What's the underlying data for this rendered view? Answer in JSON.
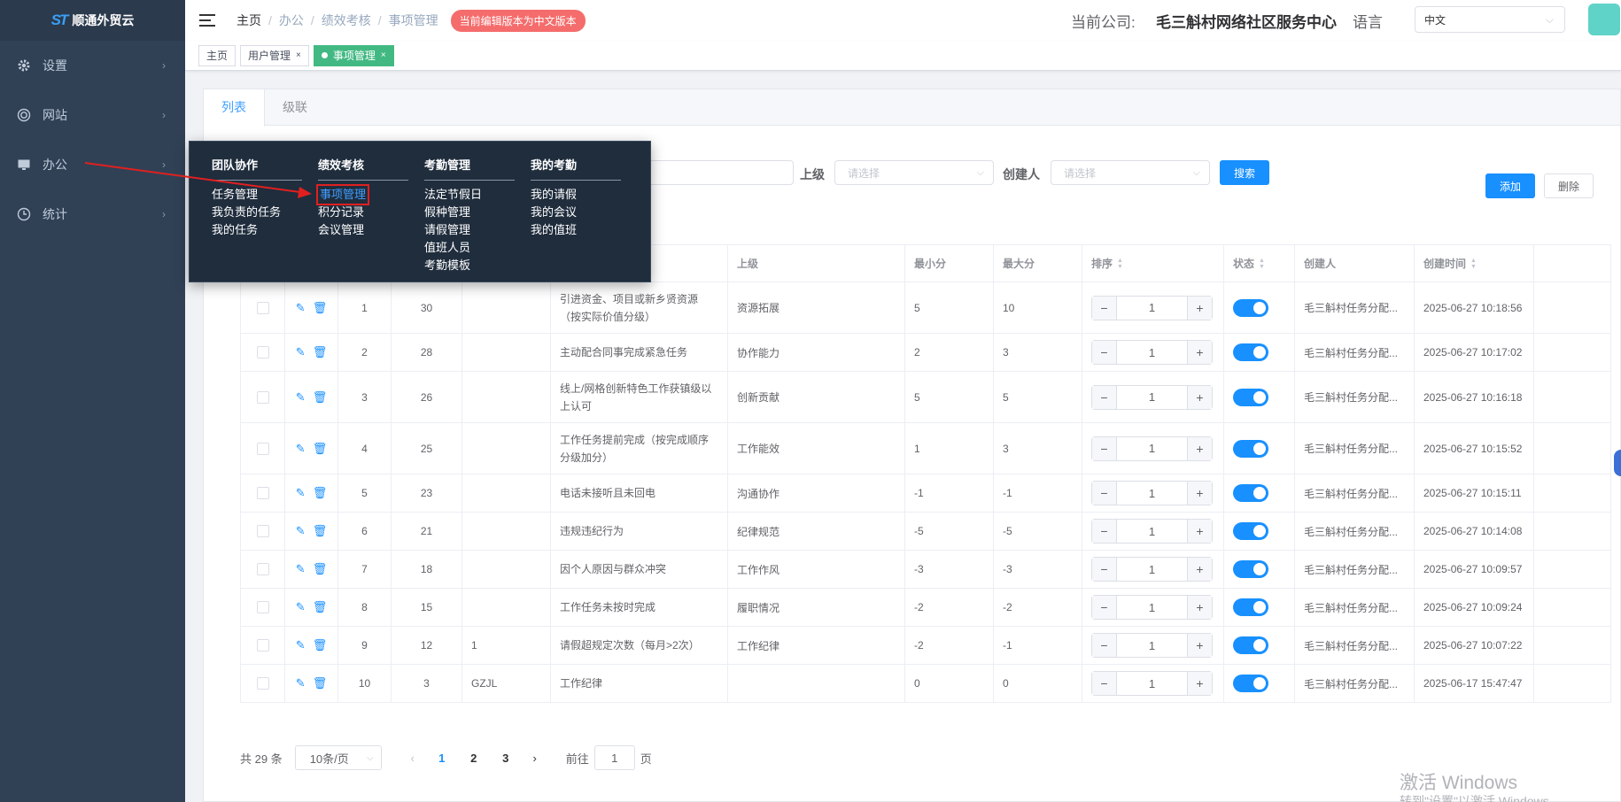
{
  "app": {
    "name": "顺通外贸云"
  },
  "sidebar": {
    "items": [
      {
        "label": "设置",
        "icon": "gear-icon"
      },
      {
        "label": "网站",
        "icon": "globe-icon"
      },
      {
        "label": "办公",
        "icon": "monitor-icon"
      },
      {
        "label": "统计",
        "icon": "clock-icon"
      }
    ]
  },
  "header": {
    "breadcrumb": [
      "主页",
      "办公",
      "绩效考核",
      "事项管理"
    ],
    "notice": "当前编辑版本为中文版本",
    "company_label": "当前公司:",
    "company_name": "毛三斛村网络社区服务中心",
    "lang_label": "语言",
    "lang_value": "中文"
  },
  "tags": [
    {
      "label": "主页"
    },
    {
      "label": "用户管理",
      "close": "×"
    },
    {
      "label": "事项管理",
      "close": "×"
    }
  ],
  "tabs": [
    "列表",
    "级联"
  ],
  "search": {
    "parent_label": "上级",
    "parent_placeholder": "请选择",
    "creator_label": "创建人",
    "creator_placeholder": "请选择",
    "search_button": "搜索"
  },
  "actions": {
    "add": "添加",
    "delete": "删除"
  },
  "table": {
    "headers": {
      "parent": "上级",
      "min": "最小分",
      "max": "最大分",
      "sort": "排序",
      "status": "状态",
      "creator": "创建人",
      "time": "创建时间"
    },
    "rows": [
      {
        "id": "1",
        "score": "30",
        "code": "",
        "name": "引进资金、项目或新乡贤资源（按实际价值分级）",
        "parent": "资源拓展",
        "min": "5",
        "max": "10",
        "sort": "1",
        "creator": "毛三斛村任务分配...",
        "time": "2025-06-27 10:18:56"
      },
      {
        "id": "2",
        "score": "28",
        "code": "",
        "name": "主动配合同事完成紧急任务",
        "parent": "协作能力",
        "min": "2",
        "max": "3",
        "sort": "1",
        "creator": "毛三斛村任务分配...",
        "time": "2025-06-27 10:17:02"
      },
      {
        "id": "3",
        "score": "26",
        "code": "",
        "name": "线上/网格创新特色工作获镇级以上认可",
        "parent": "创新贡献",
        "min": "5",
        "max": "5",
        "sort": "1",
        "creator": "毛三斛村任务分配...",
        "time": "2025-06-27 10:16:18"
      },
      {
        "id": "4",
        "score": "25",
        "code": "",
        "name": "工作任务提前完成（按完成顺序分级加分）",
        "parent": "工作能效",
        "min": "1",
        "max": "3",
        "sort": "1",
        "creator": "毛三斛村任务分配...",
        "time": "2025-06-27 10:15:52"
      },
      {
        "id": "5",
        "score": "23",
        "code": "",
        "name": "电话未接听且未回电",
        "parent": "沟通协作",
        "min": "-1",
        "max": "-1",
        "sort": "1",
        "creator": "毛三斛村任务分配...",
        "time": "2025-06-27 10:15:11"
      },
      {
        "id": "6",
        "score": "21",
        "code": "",
        "name": "违规违纪行为",
        "parent": "纪律规范",
        "min": "-5",
        "max": "-5",
        "sort": "1",
        "creator": "毛三斛村任务分配...",
        "time": "2025-06-27 10:14:08"
      },
      {
        "id": "7",
        "score": "18",
        "code": "",
        "name": "因个人原因与群众冲突",
        "parent": "工作作风",
        "min": "-3",
        "max": "-3",
        "sort": "1",
        "creator": "毛三斛村任务分配...",
        "time": "2025-06-27 10:09:57"
      },
      {
        "id": "8",
        "score": "15",
        "code": "",
        "name": "工作任务未按时完成",
        "parent": "履职情况",
        "min": "-2",
        "max": "-2",
        "sort": "1",
        "creator": "毛三斛村任务分配...",
        "time": "2025-06-27 10:09:24"
      },
      {
        "id": "9",
        "score": "12",
        "code": "1",
        "name": "请假超规定次数（每月>2次）",
        "parent": "工作纪律",
        "min": "-2",
        "max": "-1",
        "sort": "1",
        "creator": "毛三斛村任务分配...",
        "time": "2025-06-27 10:07:22"
      },
      {
        "id": "10",
        "score": "3",
        "code": "GZJL",
        "name": "工作纪律",
        "parent": "",
        "min": "0",
        "max": "0",
        "sort": "1",
        "creator": "毛三斛村任务分配...",
        "time": "2025-06-17 15:47:47"
      }
    ]
  },
  "pagination": {
    "total": "共 29 条",
    "page_size": "10条/页",
    "pages": [
      "1",
      "2",
      "3"
    ],
    "goto_label": "前往",
    "goto_value": "1",
    "page_suffix": "页"
  },
  "mega_menu": {
    "columns": [
      {
        "title": "团队协作",
        "links": [
          "任务管理",
          "我负责的任务",
          "我的任务"
        ]
      },
      {
        "title": "绩效考核",
        "links": [
          "事项管理",
          "积分记录",
          "会议管理"
        ]
      },
      {
        "title": "考勤管理",
        "links": [
          "法定节假日",
          "假种管理",
          "请假管理",
          "值班人员",
          "考勤模板"
        ]
      },
      {
        "title": "我的考勤",
        "links": [
          "我的请假",
          "我的会议",
          "我的值班"
        ]
      }
    ]
  },
  "watermark": {
    "line1": "激活 Windows",
    "line2": "转到\"设置\"以激活 Windows。"
  }
}
